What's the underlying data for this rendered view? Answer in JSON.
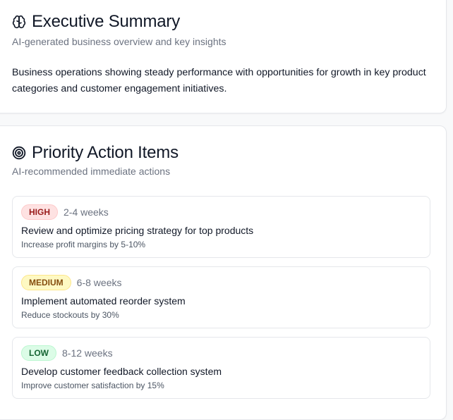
{
  "summary": {
    "title": "Executive Summary",
    "icon": "brain-icon",
    "subtitle": "AI-generated business overview and key insights",
    "body": "Business operations showing steady performance with opportunities for growth in key product categories and customer engagement initiatives."
  },
  "actions": {
    "title": "Priority Action Items",
    "icon": "target-icon",
    "subtitle": "AI-recommended immediate actions",
    "items": [
      {
        "priority": "HIGH",
        "timeline": "2-4 weeks",
        "title": "Review and optimize pricing strategy for top products",
        "impact": "Increase profit margins by 5-10%"
      },
      {
        "priority": "MEDIUM",
        "timeline": "6-8 weeks",
        "title": "Implement automated reorder system",
        "impact": "Reduce stockouts by 30%"
      },
      {
        "priority": "LOW",
        "timeline": "8-12 weeks",
        "title": "Develop customer feedback collection system",
        "impact": "Improve customer satisfaction by 15%"
      }
    ]
  },
  "colors": {
    "high_bg": "#fee2e2",
    "high_text": "#991b1b",
    "medium_bg": "#fef9c3",
    "medium_text": "#854d0e",
    "low_bg": "#dcfce7",
    "low_text": "#166534"
  }
}
